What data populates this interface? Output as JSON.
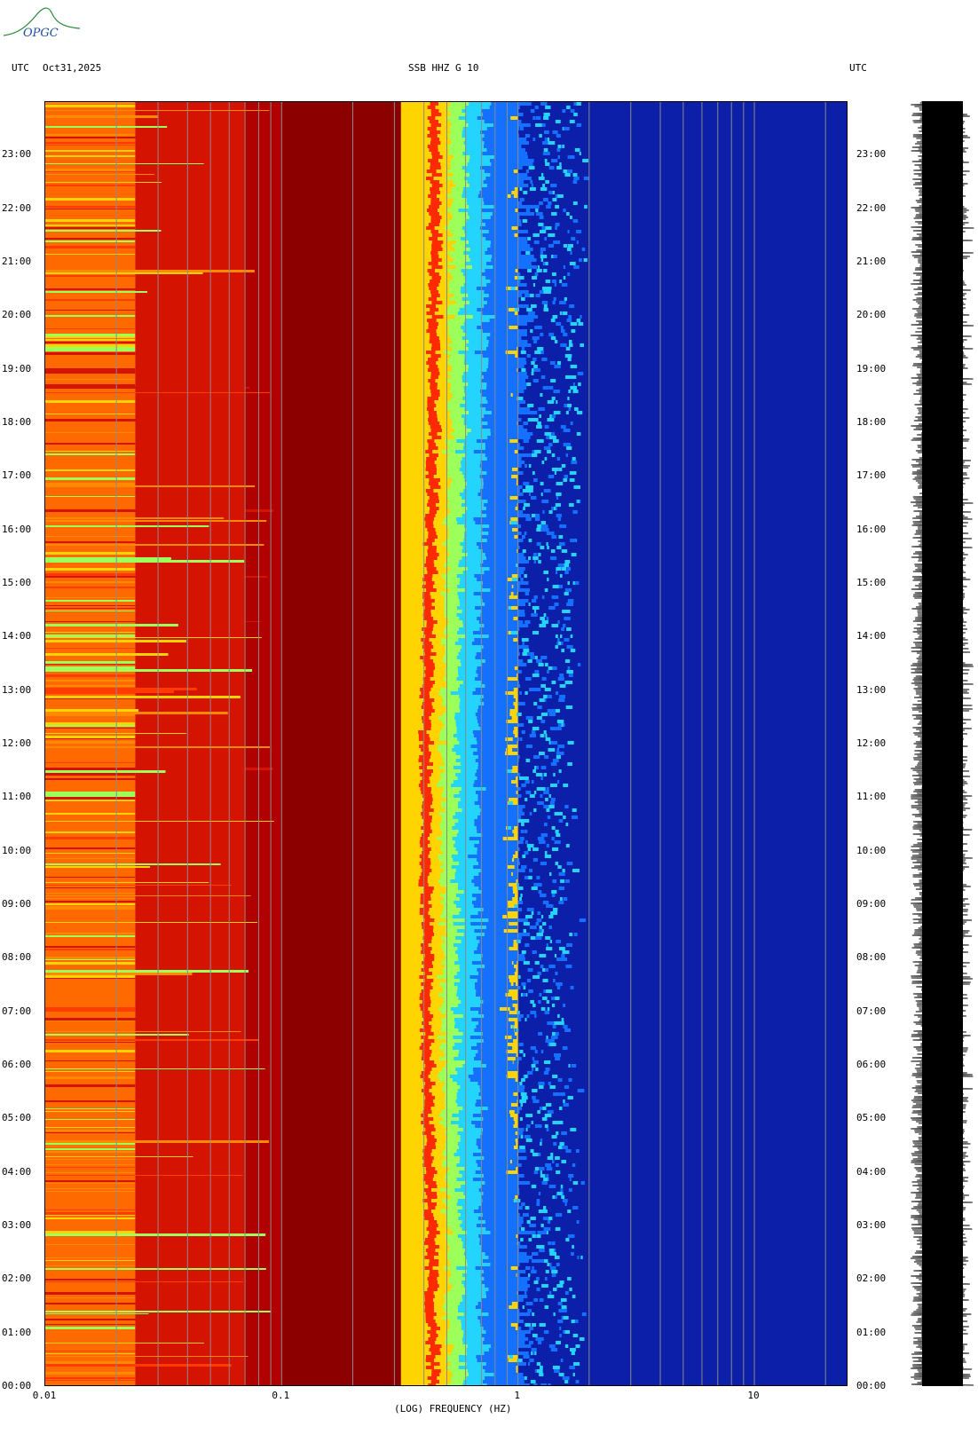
{
  "header": {
    "left_label": "UTC",
    "date": "Oct31,2025",
    "station": "SSB HHZ G 10",
    "right_label": "UTC"
  },
  "logo": {
    "text": "OPGC",
    "color": "#2a8a3a"
  },
  "colors": {
    "low_freq_band": "#b80000",
    "mid_band": "#8c0000",
    "transition": [
      "#ff2a00",
      "#ffd400",
      "#9cff5a",
      "#23d4ff",
      "#1470ff"
    ],
    "high_freq": "#0b1fa8",
    "gridline": "#8a8a8a"
  },
  "chart_data": {
    "type": "heatmap",
    "title": "SSB HHZ G 10",
    "xlabel": "(LOG) FREQUENCY (HZ)",
    "x_scale": "log",
    "xlim": [
      0.01,
      25
    ],
    "x_ticks": [
      "0.01",
      "0.1",
      "1",
      "10"
    ],
    "y_ticks_left": [
      "23:00",
      "22:00",
      "21:00",
      "20:00",
      "19:00",
      "18:00",
      "17:00",
      "16:00",
      "15:00",
      "14:00",
      "13:00",
      "12:00",
      "11:00",
      "10:00",
      "09:00",
      "08:00",
      "07:00",
      "06:00",
      "05:00",
      "04:00",
      "03:00",
      "02:00",
      "01:00",
      "00:00"
    ],
    "y_ticks_right": [
      "23:00",
      "22:00",
      "21:00",
      "20:00",
      "19:00",
      "18:00",
      "17:00",
      "16:00",
      "15:00",
      "14:00",
      "13:00",
      "12:00",
      "11:00",
      "10:00",
      "09:00",
      "08:00",
      "07:00",
      "06:00",
      "05:00",
      "04:00",
      "03:00",
      "02:00",
      "01:00",
      "00:00"
    ],
    "y_hours": [
      23,
      22,
      21,
      20,
      19,
      18,
      17,
      16,
      15,
      14,
      13,
      12,
      11,
      10,
      9,
      8,
      7,
      6,
      5,
      4,
      3,
      2,
      1,
      0
    ],
    "ylim_hours": [
      0,
      24
    ],
    "gridline_freqs": [
      0.02,
      0.03,
      0.04,
      0.05,
      0.06,
      0.07,
      0.08,
      0.09,
      0.1,
      0.2,
      0.3,
      0.4,
      0.5,
      0.6,
      0.7,
      0.8,
      0.9,
      1,
      2,
      3,
      4,
      5,
      6,
      7,
      8,
      9,
      10,
      20
    ],
    "bands": [
      {
        "from_hz": 0.01,
        "to_hz": 0.024,
        "level": "high",
        "color": "#ff6a00"
      },
      {
        "from_hz": 0.024,
        "to_hz": 0.07,
        "level": "high",
        "color": "#d41400"
      },
      {
        "from_hz": 0.07,
        "to_hz": 0.1,
        "level": "high",
        "color": "#b00000"
      },
      {
        "from_hz": 0.1,
        "to_hz": 0.32,
        "level": "saturated",
        "color": "#8c0000"
      },
      {
        "from_hz": 0.32,
        "to_hz": 1.0,
        "level": "transition",
        "color": "#ffd400"
      },
      {
        "from_hz": 1.0,
        "to_hz": 25,
        "level": "low",
        "color": "#0b1fa8"
      }
    ],
    "transition_peak_hz_by_hour": [
      {
        "hour": 0,
        "hz": 0.5
      },
      {
        "hour": 6,
        "hz": 0.47
      },
      {
        "hour": 12,
        "hz": 0.46
      },
      {
        "hour": 18,
        "hz": 0.5
      },
      {
        "hour": 24,
        "hz": 0.5
      }
    ]
  }
}
